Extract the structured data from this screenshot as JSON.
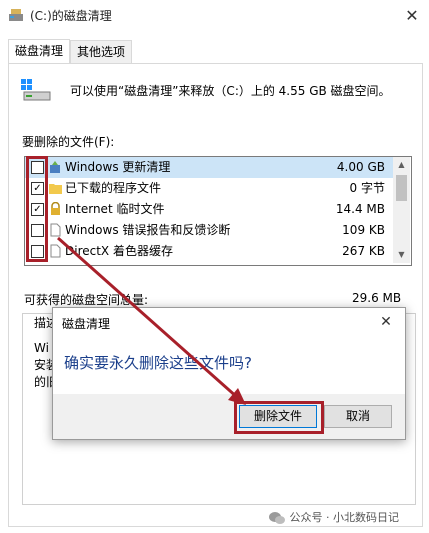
{
  "window": {
    "title": "(C:)的磁盘清理",
    "close_glyph": "✕"
  },
  "tabs": [
    {
      "label": "磁盘清理",
      "active": true
    },
    {
      "label": "其他选项",
      "active": false
    }
  ],
  "summary": "可以使用“磁盘清理”来释放（C:）上的 4.55 GB 磁盘空间。",
  "files_label": "要删除的文件(F):",
  "files": [
    {
      "name": "Windows 更新清理",
      "size": "4.00 GB",
      "checked": false,
      "icon": "windows-update-icon"
    },
    {
      "name": "已下载的程序文件",
      "size": "0 字节",
      "checked": true,
      "icon": "folder-icon"
    },
    {
      "name": "Internet 临时文件",
      "size": "14.4 MB",
      "checked": true,
      "icon": "lock-icon"
    },
    {
      "name": "Windows 错误报告和反馈诊断",
      "size": "109 KB",
      "checked": false,
      "icon": "document-icon"
    },
    {
      "name": "DirectX 着色器缓存",
      "size": "267 KB",
      "checked": false,
      "icon": "document-icon"
    }
  ],
  "gain_label": "可获得的磁盘空间总量:",
  "gain_value": "29.6 MB",
  "description": {
    "title": "描述",
    "lines": [
      "Wi",
      "安装",
      "的旧"
    ]
  },
  "dialog": {
    "title": "磁盘清理",
    "message": "确实要永久删除这些文件吗?",
    "delete_label": "删除文件",
    "cancel_label": "取消",
    "close_glyph": "✕"
  },
  "watermark": "公众号 · 小北数码日记",
  "colors": {
    "highlight": "#a8202a",
    "message": "#1b3f8b",
    "selection": "#cce4f7"
  }
}
